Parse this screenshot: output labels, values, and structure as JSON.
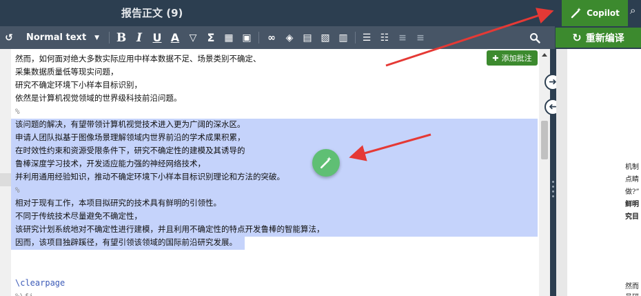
{
  "header": {
    "title": "报告正文 (9)",
    "copilot_label": "Copilot"
  },
  "toolbar": {
    "text_style": "Normal text",
    "recompile_label": "重新编译"
  },
  "editor": {
    "add_comment_label": "添加批注",
    "lines": [
      "然而，如何面对绝大多数实际应用中样本数据不足、场景类别不确定、",
      "采集数据质量低等现实问题，",
      "研究不确定环境下小样本目标识别，",
      "依然是计算机视觉领域的世界级科技前沿问题。",
      "%",
      "该问题的解决，有望带领计算机视觉技术进入更为广阔的深水区。",
      "申请人团队拟基于图像场景理解领域内世界前沿的学术成果积累，",
      "在时效性约束和资源受限条件下，研究不确定性的建模及其诱导的",
      "鲁棒深度学习技术，开发适应能力强的神经网络技术，",
      "并利用通用经验知识，推动不确定环境下小样本目标识别理论和方法的突破。",
      "%",
      "相对于现有工作，本项目拟研究的技术具有鲜明的引领性。",
      "不同于传统技术尽量避免不确定性，",
      "该研究计划系统地对不确定性进行建模，并且利用不确定性的特点开发鲁棒的智能算法，",
      "因而，该项目独辟蹊径，有望引领该领域的国际前沿研究发展。",
      "",
      "",
      "\\clearpage",
      "%\\fi"
    ]
  },
  "pdf_preview": {
    "fragments": [
      "机制",
      "点睛",
      "做?”",
      "鲜明",
      "究目",
      "然而",
      "员研"
    ]
  },
  "colors": {
    "title_bar": "#2c3e50",
    "toolbar": "#475566",
    "accent_green": "#3c8a2e",
    "selection": "#c5d3fb",
    "arrow_red": "#e53935"
  }
}
